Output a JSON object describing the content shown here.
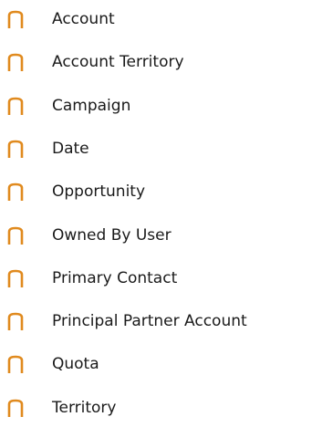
{
  "bullet": {
    "glyph": "n",
    "icon": "bullet-n-icon",
    "color": "#E08A1E"
  },
  "items": [
    {
      "label": "Account"
    },
    {
      "label": "Account Territory"
    },
    {
      "label": "Campaign"
    },
    {
      "label": "Date"
    },
    {
      "label": "Opportunity"
    },
    {
      "label": "Owned By User"
    },
    {
      "label": "Primary Contact"
    },
    {
      "label": "Principal Partner Account"
    },
    {
      "label": "Quota"
    },
    {
      "label": "Territory"
    }
  ]
}
